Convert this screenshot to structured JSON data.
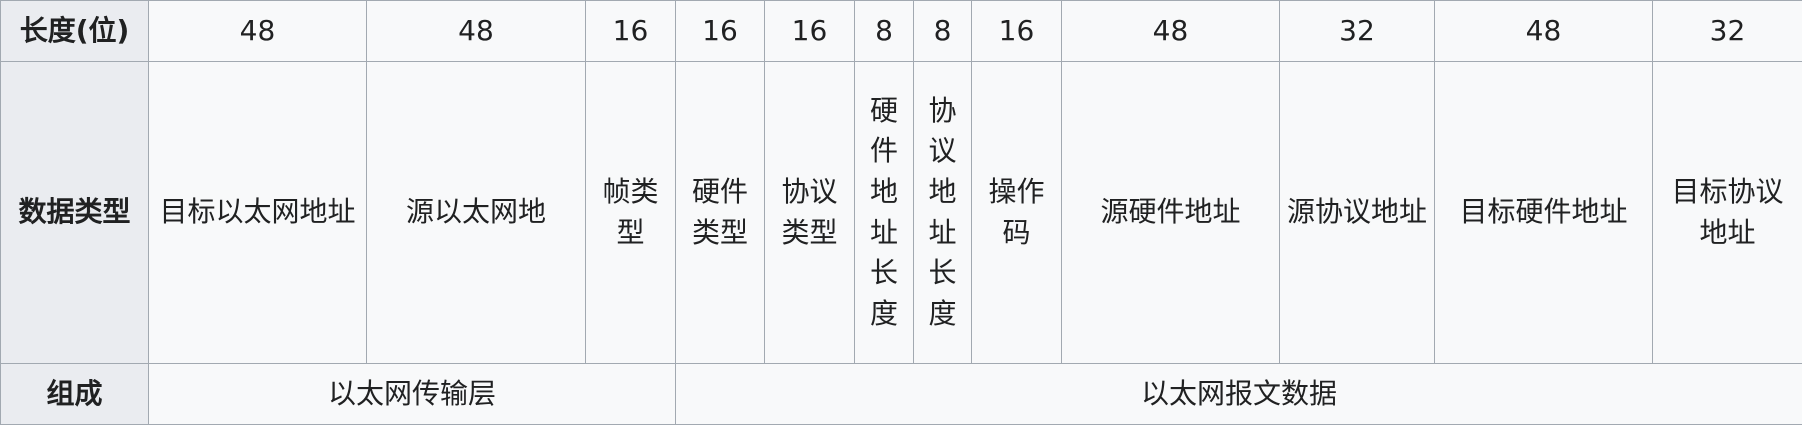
{
  "table": {
    "row_headers": {
      "length": "长度(位)",
      "data_type": "数据类型",
      "composition": "组成"
    },
    "fields": [
      {
        "length": "48",
        "type": "目标以太网地址"
      },
      {
        "length": "48",
        "type": "源以太网地"
      },
      {
        "length": "16",
        "type": "帧类型"
      },
      {
        "length": "16",
        "type": "硬件类型"
      },
      {
        "length": "16",
        "type": "协议类型"
      },
      {
        "length": "8",
        "type": "硬件地址长度"
      },
      {
        "length": "8",
        "type": "协议地址长度"
      },
      {
        "length": "16",
        "type": "操作码"
      },
      {
        "length": "48",
        "type": "源硬件地址"
      },
      {
        "length": "32",
        "type": "源协议地址"
      },
      {
        "length": "48",
        "type": "目标硬件地址"
      },
      {
        "length": "32",
        "type": "目标协议地址"
      }
    ],
    "composition": [
      {
        "label": "以太网传输层"
      },
      {
        "label": "以太网报文数据"
      }
    ]
  }
}
